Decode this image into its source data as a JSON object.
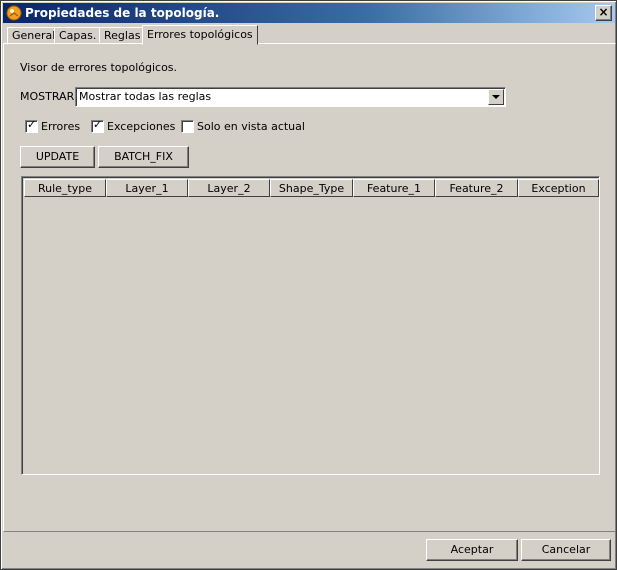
{
  "window": {
    "title": "Propiedades de la topología."
  },
  "tabs": [
    {
      "label": "General",
      "active": false
    },
    {
      "label": "Capas.",
      "active": false
    },
    {
      "label": "Reglas",
      "active": false
    },
    {
      "label": "Errores topológicos",
      "active": true
    }
  ],
  "panel": {
    "heading": "Visor de errores topológicos.",
    "show_label": "MOSTRAR",
    "show_selected": "Mostrar todas las reglas",
    "checkboxes": [
      {
        "label": "Errores",
        "checked": true
      },
      {
        "label": "Excepciones",
        "checked": true
      },
      {
        "label": "Solo en vista actual",
        "checked": false
      }
    ],
    "buttons": {
      "update": "UPDATE",
      "batch_fix": "BATCH_FIX"
    },
    "table": {
      "columns": [
        "Rule_type",
        "Layer_1",
        "Layer_2",
        "Shape_Type",
        "Feature_1",
        "Feature_2",
        "Exception"
      ],
      "rows": []
    }
  },
  "footer": {
    "accept": "Aceptar",
    "cancel": "Cancelar"
  },
  "colors": {
    "title_bar": "#0a246a",
    "face": "#d4d0c8"
  }
}
